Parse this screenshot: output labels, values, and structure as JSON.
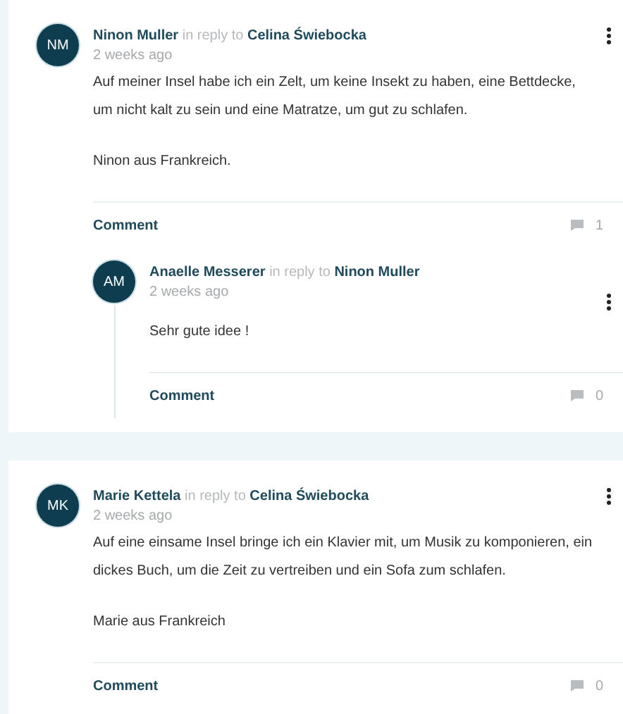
{
  "comments": [
    {
      "initials": "NM",
      "author": "Ninon Muller",
      "reply_label": "in reply to",
      "reply_to": "Celina Świebocka",
      "time": "2 weeks ago",
      "paragraphs": [
        "Auf meiner Insel habe ich ein Zelt, um keine Insekt zu haben, eine Bettdecke, um nicht kalt zu sein und eine Matratze, um gut zu schlafen.",
        "Ninon aus Frankreich."
      ],
      "action": "Comment",
      "count": "1",
      "children": [
        {
          "initials": "AM",
          "author": "Anaelle Messerer",
          "reply_label": "in reply to",
          "reply_to": "Ninon Muller",
          "time": "2 weeks ago",
          "paragraphs": [
            "Sehr gute idee !"
          ],
          "action": "Comment",
          "count": "0"
        }
      ]
    },
    {
      "initials": "MK",
      "author": "Marie Kettela",
      "reply_label": "in reply to",
      "reply_to": "Celina Świebocka",
      "time": "2 weeks ago",
      "paragraphs": [
        "Auf eine einsame Insel bringe ich ein Klavier mit, um Musik zu komponieren, ein dickes Buch, um die Zeit zu vertreiben und ein Sofa zum schlafen.",
        "Marie aus Frankreich"
      ],
      "action": "Comment",
      "count": "0"
    }
  ]
}
